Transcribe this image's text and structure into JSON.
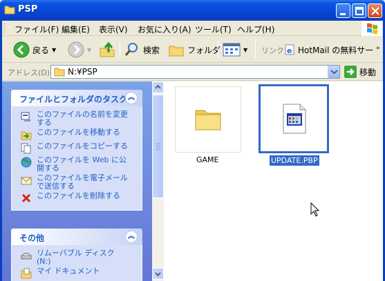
{
  "window": {
    "title": "PSP"
  },
  "menu": {
    "items": [
      "ファイル(F)",
      "編集(E)",
      "表示(V)",
      "お気に入り(A)",
      "ツール(T)",
      "ヘルプ(H)"
    ]
  },
  "toolbar": {
    "back_label": "戻る",
    "search_label": "検索",
    "folders_label": "フォルダ",
    "links_label": "リンク",
    "link_item": "HotMail の無料サー"
  },
  "address": {
    "label": "アドレス(D)",
    "value": "N:¥PSP",
    "go_label": "移動"
  },
  "tasks_panel": {
    "title": "ファイルとフォルダのタスク",
    "items": [
      "このファイルの名前を変更する",
      "このファイルを移動する",
      "このファイルをコピーする",
      "このファイルを Web に公開する",
      "このファイルを電子メールで送信する",
      "このファイルを削除する"
    ]
  },
  "other_panel": {
    "title": "その他",
    "items": [
      "リムーバブル ディスク (N:)",
      "マイ ドキュメント"
    ]
  },
  "files": [
    {
      "name": "GAME",
      "type": "folder",
      "selected": false
    },
    {
      "name": "UPDATE.PBP",
      "type": "file",
      "selected": true
    }
  ],
  "colors": {
    "titlebar": "#0a55e3",
    "task_link": "#215dc6",
    "selection": "#316ac5"
  }
}
